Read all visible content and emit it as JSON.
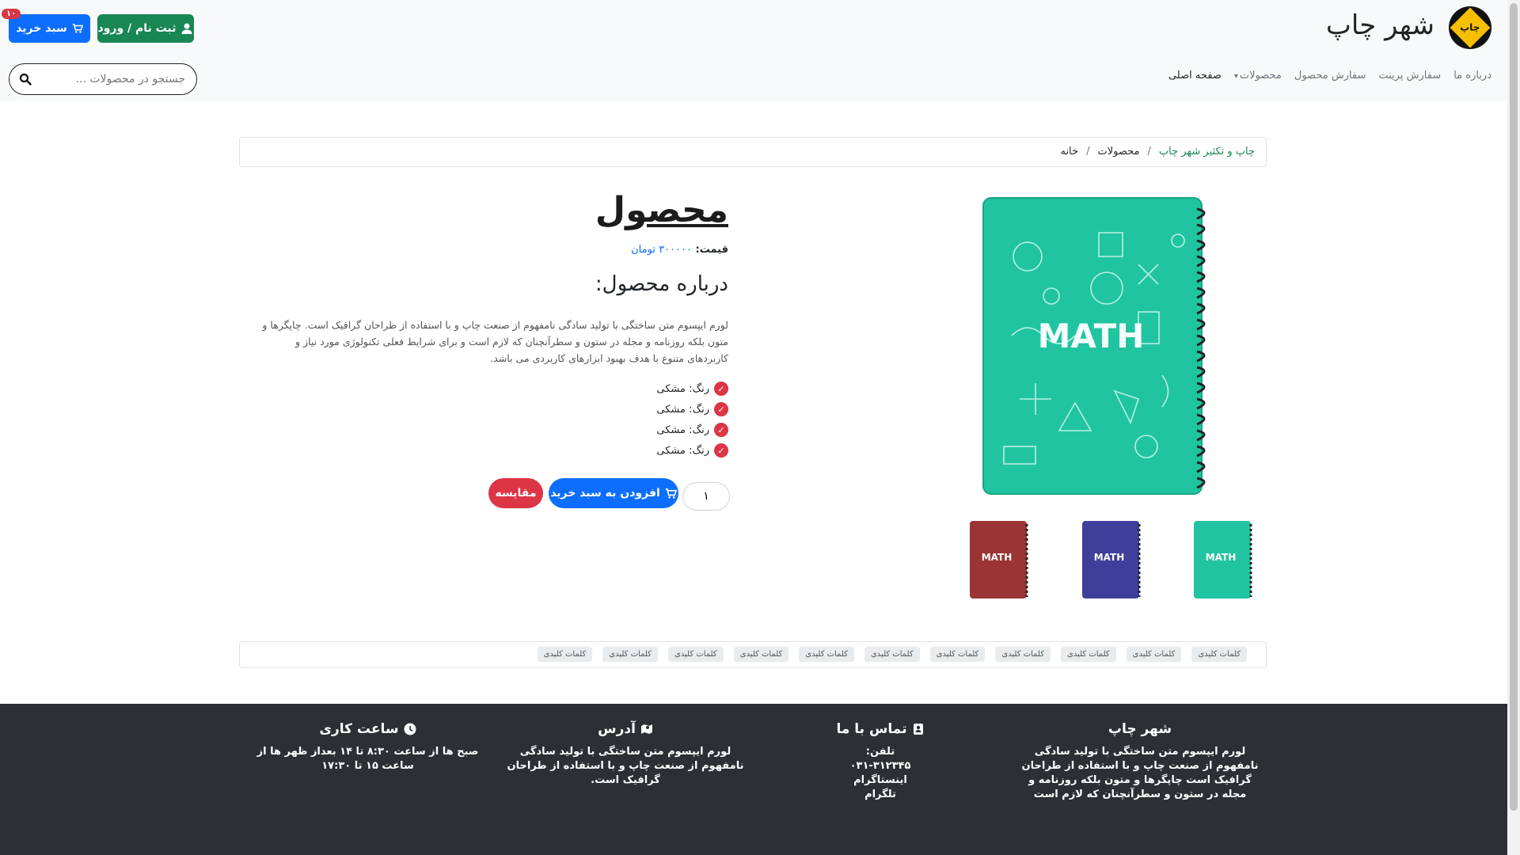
{
  "header": {
    "brand": "شهر چاپ",
    "logo_text": "چاپ",
    "register_label": "ثبت نام / ورود",
    "cart_label": "سبد خرید",
    "cart_count": "۱۰",
    "search_placeholder": "جستجو در محصولات ...",
    "nav": [
      {
        "label": "صفحه اصلی"
      },
      {
        "label": "محصولات"
      },
      {
        "label": "سفارش محصول"
      },
      {
        "label": "سفارش پرینت"
      },
      {
        "label": "درباره ما"
      }
    ]
  },
  "breadcrumb": {
    "home": "خانه",
    "products": "محصولات",
    "current": "چاپ و تکثیر شهر چاپ",
    "separator": "/"
  },
  "product": {
    "title": "محصول",
    "price_label": "قیمت:",
    "price_value": "۳۰۰۰۰۰ تومان",
    "about_heading": "درباره محصول:",
    "description": "لورم ایپسوم متن ساختگی با تولید سادگی نامفهوم از صنعت چاپ و با استفاده از طراحان گرافیک است. چاپگرها و متون بلکه روزنامه و مجله در ستون و سطرآنچنان که لازم است و برای شرایط فعلی تکنولوژی مورد نیاز و کاربردهای متنوع با هدف بهبود ابزارهای کاربردی می باشد.",
    "features": [
      "رنگ: مشکی",
      "رنگ: مشکی",
      "رنگ: مشکی",
      "رنگ: مشکی"
    ],
    "quantity": "۱",
    "add_to_cart_label": "افزودن به سبد خرید",
    "compare_label": "مقایسه",
    "cover_text": "MATH",
    "thumbnails": [
      {
        "color": "#21c4a0"
      },
      {
        "color": "#3f3f9b"
      },
      {
        "color": "#9b3535"
      }
    ]
  },
  "keywords": [
    "کلمات کلیدی",
    "کلمات کلیدی",
    "کلمات کلیدی",
    "کلمات کلیدی",
    "کلمات کلیدی",
    "کلمات کلیدی",
    "کلمات کلیدی",
    "کلمات کلیدی",
    "کلمات کلیدی",
    "کلمات کلیدی",
    "کلمات کلیدی"
  ],
  "footer": {
    "about": {
      "title": "شهر چاپ",
      "text": "لورم ایپسوم متن ساختگی با تولید سادگی نامفهوم از صنعت چاپ و با استفاده از طراحان گرافیک است چاپگرها و متون بلکه روزنامه و مجله در ستون و سطرآنچنان که لازم است"
    },
    "contact": {
      "title": "تماس با ما",
      "phone_label": "تلفن:",
      "phone": "۰۳۱-۳۱۲۳۴۵",
      "instagram": "اینستاگرام",
      "telegram": "تلگرام"
    },
    "address": {
      "title": "آدرس",
      "text": "لورم ایپسوم متن ساختگی با تولید سادگی نامفهوم از صنعت چاپ و با استفاده از طراحان گرافیک است."
    },
    "hours": {
      "title": "ساعت کاری",
      "text": "صبح ها از ساعت ۸:۳۰ تا ۱۴ بعداز ظهر ها از ساعت ۱۵ تا ۱۷:۳۰"
    }
  },
  "colors": {
    "primary": "#0d6efd",
    "success": "#198754",
    "danger": "#dc3545",
    "footer_bg": "#2c2f33"
  }
}
